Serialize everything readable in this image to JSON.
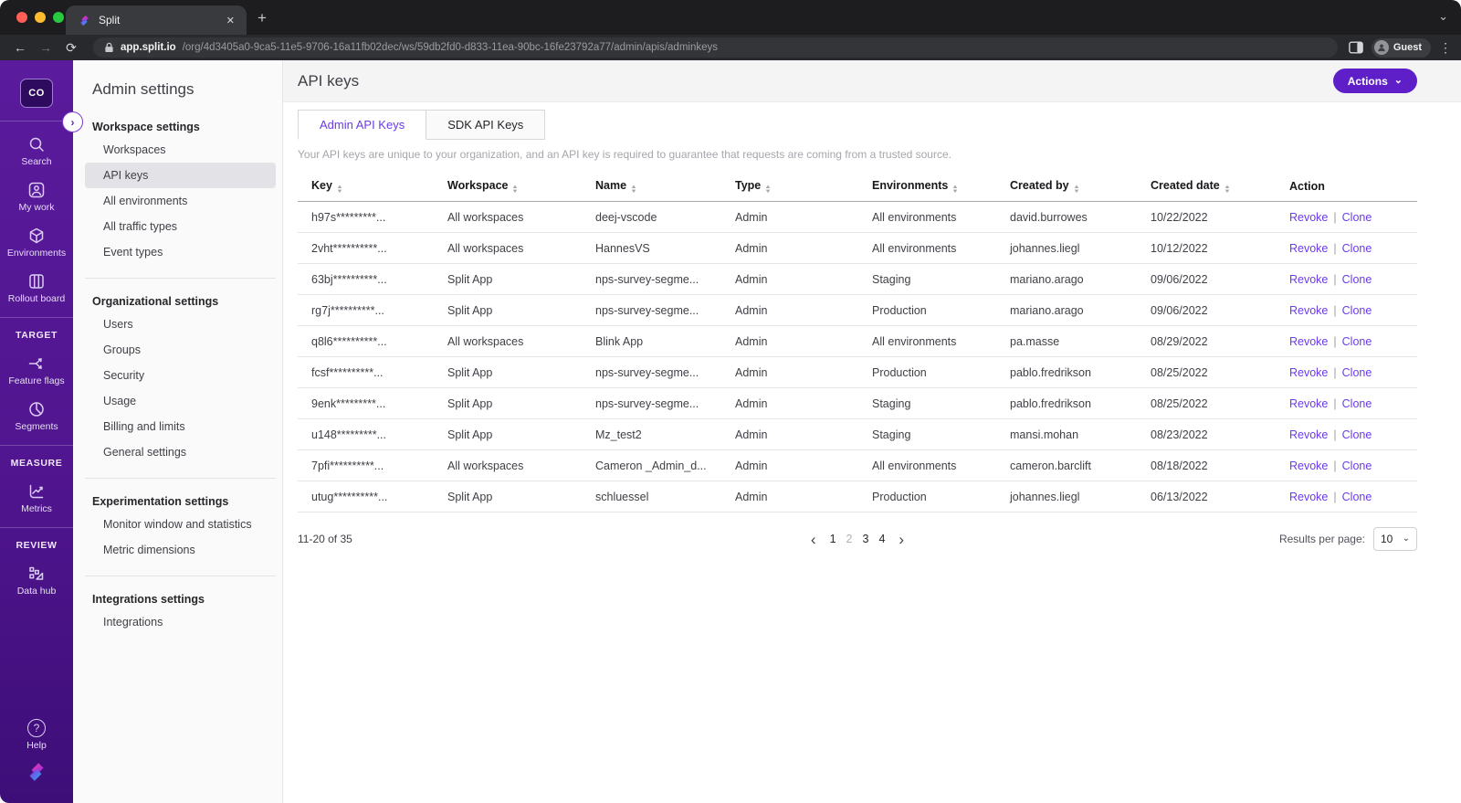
{
  "browser": {
    "tab_title": "Split",
    "url_host": "app.split.io",
    "url_path": "/org/4d3405a0-9ca5-11e5-9706-16a11fb02dec/ws/59db2fd0-d833-11ea-90bc-16fe23792a77/admin/apis/adminkeys",
    "profile_label": "Guest"
  },
  "glyphs": {
    "close": "✕",
    "plus": "+",
    "back": "←",
    "forward": "→",
    "reload": "⟳",
    "chevron_down": "⌄",
    "dots": "⋮",
    "prev": "‹",
    "next": "›",
    "pipe": "|",
    "sort_up": "▲",
    "sort_down": "▼",
    "help": "?",
    "expand": "›"
  },
  "colors": {
    "accent_purple": "#6b3be8",
    "button_purple": "#5e1fc9",
    "rail_purple": "#54179a"
  },
  "rail": {
    "workspace_initials": "CO",
    "items": {
      "search": "Search",
      "my_work": "My work",
      "environments": "Environments",
      "rollout_board": "Rollout board",
      "feature_flags": "Feature flags",
      "segments": "Segments",
      "metrics": "Metrics",
      "data_hub": "Data hub",
      "help": "Help"
    },
    "sections": {
      "target": "TARGET",
      "measure": "MEASURE",
      "review": "REVIEW"
    }
  },
  "nav": {
    "title": "Admin settings",
    "groups": [
      {
        "heading": "Workspace settings",
        "items": [
          "Workspaces",
          "API keys",
          "All environments",
          "All traffic types",
          "Event types"
        ],
        "selected": "API keys"
      },
      {
        "heading": "Organizational settings",
        "items": [
          "Users",
          "Groups",
          "Security",
          "Usage",
          "Billing and limits",
          "General settings"
        ]
      },
      {
        "heading": "Experimentation settings",
        "items": [
          "Monitor window and statistics",
          "Metric dimensions"
        ]
      },
      {
        "heading": "Integrations settings",
        "items": [
          "Integrations"
        ]
      }
    ]
  },
  "main": {
    "title": "API keys",
    "actions_label": "Actions",
    "tabs": [
      {
        "label": "Admin API Keys",
        "active": true
      },
      {
        "label": "SDK API Keys",
        "active": false
      }
    ],
    "description": "Your API keys are unique to your organization, and an API key is required to guarantee that requests are coming from a trusted source.",
    "table": {
      "columns": [
        {
          "label": "Key",
          "sortable": true
        },
        {
          "label": "Workspace",
          "sortable": true
        },
        {
          "label": "Name",
          "sortable": true
        },
        {
          "label": "Type",
          "sortable": true
        },
        {
          "label": "Environments",
          "sortable": true
        },
        {
          "label": "Created by",
          "sortable": true
        },
        {
          "label": "Created date",
          "sortable": true
        },
        {
          "label": "Action",
          "sortable": false
        }
      ],
      "action_labels": [
        "Revoke",
        "Clone"
      ],
      "rows": [
        {
          "key": "h97s*********...",
          "workspace": "All workspaces",
          "name": "deej-vscode",
          "type": "Admin",
          "environments": "All environments",
          "created_by": "david.burrowes",
          "created_date": "10/22/2022"
        },
        {
          "key": "2vht**********...",
          "workspace": "All workspaces",
          "name": "HannesVS",
          "type": "Admin",
          "environments": "All environments",
          "created_by": "johannes.liegl",
          "created_date": "10/12/2022"
        },
        {
          "key": "63bj**********...",
          "workspace": "Split App",
          "name": "nps-survey-segme...",
          "type": "Admin",
          "environments": "Staging",
          "created_by": "mariano.arago",
          "created_date": "09/06/2022"
        },
        {
          "key": "rg7j**********...",
          "workspace": "Split App",
          "name": "nps-survey-segme...",
          "type": "Admin",
          "environments": "Production",
          "created_by": "mariano.arago",
          "created_date": "09/06/2022"
        },
        {
          "key": "q8l6**********...",
          "workspace": "All workspaces",
          "name": "Blink App",
          "type": "Admin",
          "environments": "All environments",
          "created_by": "pa.masse",
          "created_date": "08/29/2022"
        },
        {
          "key": "fcsf**********...",
          "workspace": "Split App",
          "name": "nps-survey-segme...",
          "type": "Admin",
          "environments": "Production",
          "created_by": "pablo.fredrikson",
          "created_date": "08/25/2022"
        },
        {
          "key": "9enk*********...",
          "workspace": "Split App",
          "name": "nps-survey-segme...",
          "type": "Admin",
          "environments": "Staging",
          "created_by": "pablo.fredrikson",
          "created_date": "08/25/2022"
        },
        {
          "key": "u148*********...",
          "workspace": "Split App",
          "name": "Mz_test2",
          "type": "Admin",
          "environments": "Staging",
          "created_by": "mansi.mohan",
          "created_date": "08/23/2022"
        },
        {
          "key": "7pfi**********...",
          "workspace": "All workspaces",
          "name": "Cameron _Admin_d...",
          "type": "Admin",
          "environments": "All environments",
          "created_by": "cameron.barclift",
          "created_date": "08/18/2022"
        },
        {
          "key": "utug**********...",
          "workspace": "Split App",
          "name": "schluessel",
          "type": "Admin",
          "environments": "Production",
          "created_by": "johannes.liegl",
          "created_date": "06/13/2022"
        }
      ]
    },
    "pagination": {
      "range_label": "11-20 of 35",
      "pages": [
        "1",
        "2",
        "3",
        "4"
      ],
      "current_page": "2",
      "results_label": "Results per page:",
      "per_page": "10"
    }
  }
}
